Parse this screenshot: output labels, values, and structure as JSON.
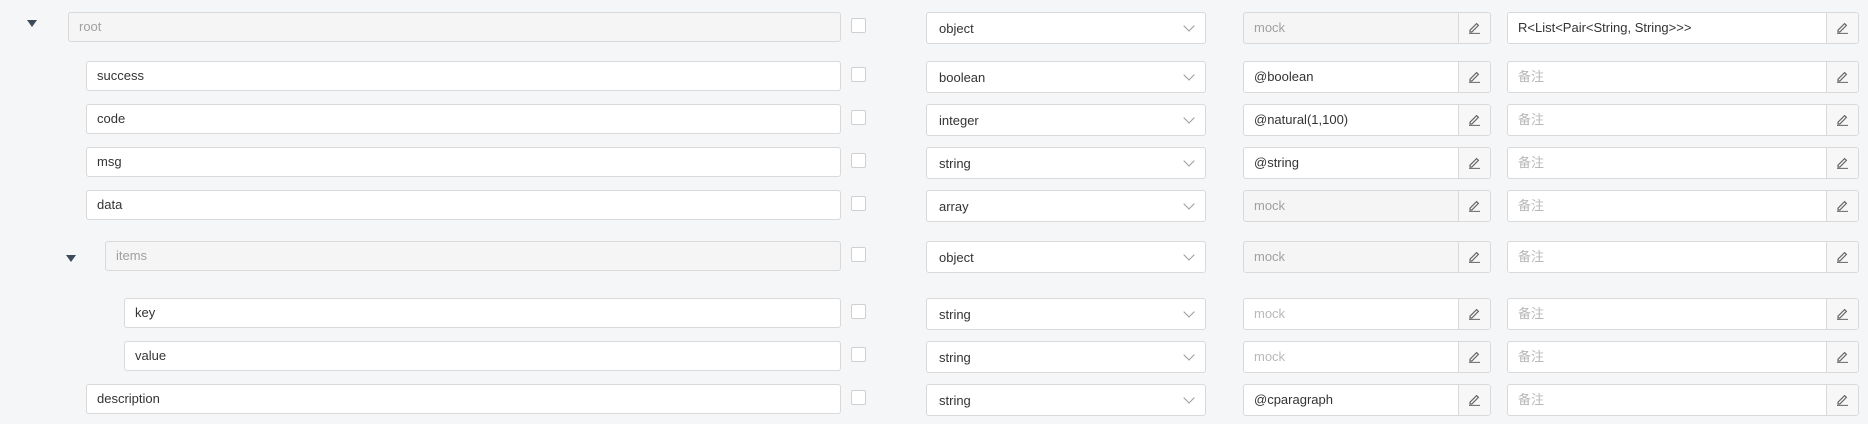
{
  "rows": [
    {
      "name": "root",
      "type": "object",
      "mock": "mock",
      "remark": "R<List<Pair<String, String>>>"
    },
    {
      "name": "success",
      "type": "boolean",
      "mock": "@boolean",
      "remark": "备注"
    },
    {
      "name": "code",
      "type": "integer",
      "mock": "@natural(1,100)",
      "remark": "备注"
    },
    {
      "name": "msg",
      "type": "string",
      "mock": "@string",
      "remark": "备注"
    },
    {
      "name": "data",
      "type": "array",
      "mock": "mock",
      "remark": "备注"
    },
    {
      "name": "items",
      "type": "object",
      "mock": "mock",
      "remark": "备注"
    },
    {
      "name": "key",
      "type": "string",
      "mock": "mock",
      "remark": "备注"
    },
    {
      "name": "value",
      "type": "string",
      "mock": "mock",
      "remark": "备注"
    },
    {
      "name": "description",
      "type": "string",
      "mock": "@cparagraph",
      "remark": "备注"
    }
  ],
  "icons": {
    "collapse": "caret-down-icon",
    "dropdown": "chevron-down-icon",
    "edit": "pencil-icon"
  },
  "colors": {
    "background": "#f5f6f7",
    "border": "#d9d9d9",
    "disabled_field": "#f5f5f5",
    "muted_text": "#a0a0a0",
    "placeholder_text": "#b8b8b8"
  }
}
